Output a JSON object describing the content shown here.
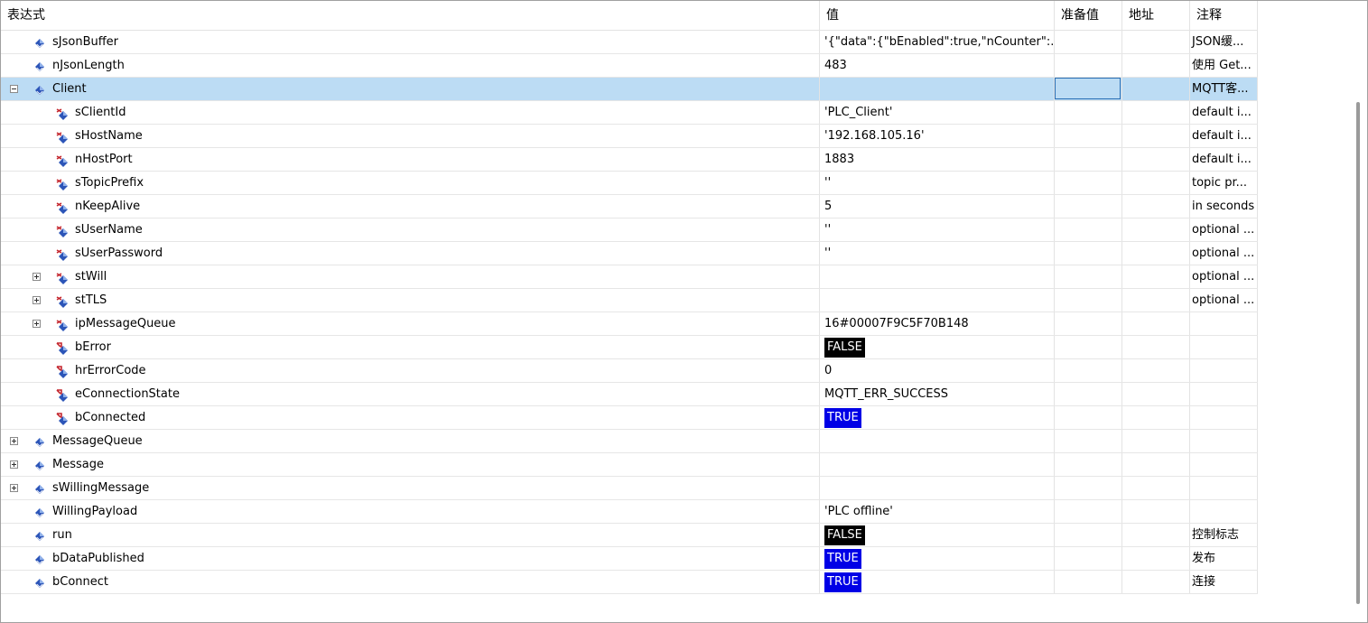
{
  "columns": {
    "expression": "表达式",
    "value": "值",
    "prepared_value": "准备值",
    "address": "地址",
    "comment": "注释"
  },
  "rows": [
    {
      "name": "sJsonBuffer",
      "value": "'{\"data\":{\"bEnabled\":true,\"nCounter\":...",
      "comment": "JSON缓...",
      "level": 0,
      "expander": "none",
      "icon": "variable-icon"
    },
    {
      "name": "nJsonLength",
      "value": "483",
      "comment": "使用 Get...",
      "level": 0,
      "expander": "none",
      "icon": "variable-icon"
    },
    {
      "name": "Client",
      "value": "",
      "comment": "MQTT客...",
      "level": 0,
      "expander": "minus",
      "icon": "variable-icon",
      "selected": true
    },
    {
      "name": "sClientId",
      "value": "'PLC_Client'",
      "comment": "default i...",
      "level": 1,
      "expander": "none",
      "icon": "input-variable-icon"
    },
    {
      "name": "sHostName",
      "value": "'192.168.105.16'",
      "comment": "default i...",
      "level": 1,
      "expander": "none",
      "icon": "input-variable-icon"
    },
    {
      "name": "nHostPort",
      "value": "1883",
      "comment": "default i...",
      "level": 1,
      "expander": "none",
      "icon": "input-variable-icon"
    },
    {
      "name": "sTopicPrefix",
      "value": "''",
      "comment": "topic pr...",
      "level": 1,
      "expander": "none",
      "icon": "input-variable-icon"
    },
    {
      "name": "nKeepAlive",
      "value": "5",
      "comment": "in seconds",
      "level": 1,
      "expander": "none",
      "icon": "input-variable-icon"
    },
    {
      "name": "sUserName",
      "value": "''",
      "comment": "optional ...",
      "level": 1,
      "expander": "none",
      "icon": "input-variable-icon"
    },
    {
      "name": "sUserPassword",
      "value": "''",
      "comment": "optional ...",
      "level": 1,
      "expander": "none",
      "icon": "input-variable-icon"
    },
    {
      "name": "stWill",
      "value": "",
      "comment": "optional ...",
      "level": 1,
      "expander": "plus",
      "icon": "input-variable-icon"
    },
    {
      "name": "stTLS",
      "value": "",
      "comment": "optional ...",
      "level": 1,
      "expander": "plus",
      "icon": "input-variable-icon"
    },
    {
      "name": "ipMessageQueue",
      "value": "16#00007F9C5F70B148",
      "comment": "",
      "level": 1,
      "expander": "plus",
      "icon": "input-variable-icon"
    },
    {
      "name": "bError",
      "value": "FALSE",
      "badge": "false",
      "comment": "",
      "level": 1,
      "expander": "none",
      "icon": "output-variable-icon"
    },
    {
      "name": "hrErrorCode",
      "value": "0",
      "comment": "",
      "level": 1,
      "expander": "none",
      "icon": "output-variable-icon"
    },
    {
      "name": "eConnectionState",
      "value": "MQTT_ERR_SUCCESS",
      "comment": "",
      "level": 1,
      "expander": "none",
      "icon": "output-variable-icon"
    },
    {
      "name": "bConnected",
      "value": "TRUE",
      "badge": "true",
      "comment": "",
      "level": 1,
      "expander": "none",
      "icon": "output-variable-icon"
    },
    {
      "name": "MessageQueue",
      "value": "",
      "comment": "",
      "level": 0,
      "expander": "plus",
      "icon": "variable-icon"
    },
    {
      "name": "Message",
      "value": "",
      "comment": "",
      "level": 0,
      "expander": "plus",
      "icon": "variable-icon"
    },
    {
      "name": "sWillingMessage",
      "value": "",
      "comment": "",
      "level": 0,
      "expander": "plus",
      "icon": "variable-icon"
    },
    {
      "name": "WillingPayload",
      "value": "'PLC offline'",
      "comment": "",
      "level": 0,
      "expander": "none",
      "icon": "variable-icon"
    },
    {
      "name": "run",
      "value": "FALSE",
      "badge": "false",
      "comment": "控制标志",
      "level": 0,
      "expander": "none",
      "icon": "variable-icon"
    },
    {
      "name": "bDataPublished",
      "value": "TRUE",
      "badge": "true",
      "comment": "发布",
      "level": 0,
      "expander": "none",
      "icon": "variable-icon"
    },
    {
      "name": "bConnect",
      "value": "TRUE",
      "badge": "true",
      "comment": "连接",
      "level": 0,
      "expander": "none",
      "icon": "variable-icon"
    }
  ],
  "colors": {
    "selected_row": "#bcdcf4",
    "true_badge": "#0000e6",
    "false_badge": "#000000",
    "icon_blue": "#2c55b8",
    "icon_red": "#c4262e"
  }
}
